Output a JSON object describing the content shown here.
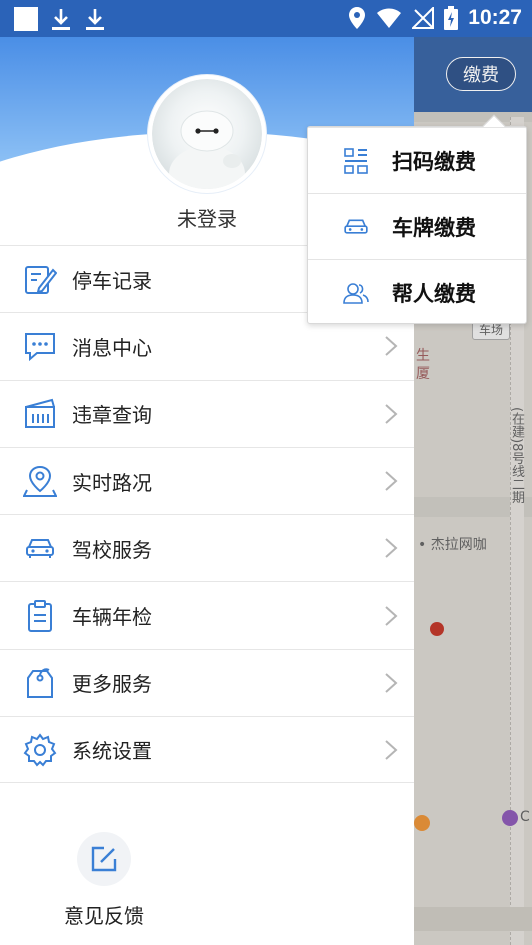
{
  "status_bar": {
    "time": "10:27"
  },
  "topbar": {
    "fee_button": "缴费"
  },
  "drawer": {
    "login_label": "未登录",
    "menu": [
      {
        "label": "停车记录",
        "icon": "parking-record-icon"
      },
      {
        "label": "消息中心",
        "icon": "message-icon"
      },
      {
        "label": "违章查询",
        "icon": "violation-icon"
      },
      {
        "label": "实时路况",
        "icon": "traffic-icon"
      },
      {
        "label": "驾校服务",
        "icon": "car-icon"
      },
      {
        "label": "车辆年检",
        "icon": "clipboard-icon"
      },
      {
        "label": "更多服务",
        "icon": "tag-icon"
      },
      {
        "label": "系统设置",
        "icon": "gear-icon"
      }
    ],
    "feedback_label": "意见反馈"
  },
  "popup": {
    "items": [
      {
        "label": "扫码缴费",
        "icon": "qr-scan-icon"
      },
      {
        "label": "车牌缴费",
        "icon": "car-icon"
      },
      {
        "label": "帮人缴费",
        "icon": "people-icon"
      }
    ]
  },
  "map": {
    "labels": [
      "车场",
      "生",
      "厦",
      "(在建)8号线二期",
      "杰拉网咖",
      "C"
    ]
  },
  "colors": {
    "accent": "#2b63b8",
    "icon_blue": "#3a7fd5"
  }
}
